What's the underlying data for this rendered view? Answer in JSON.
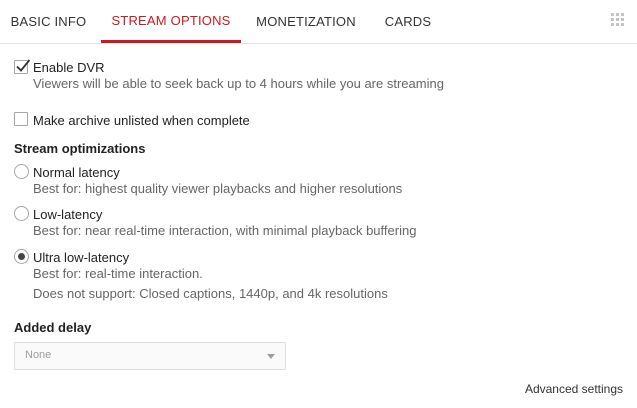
{
  "tabs": {
    "basic_info": "BASIC INFO",
    "stream_options": "STREAM OPTIONS",
    "monetization": "MONETIZATION",
    "cards": "CARDS"
  },
  "active_tab": "STREAM OPTIONS",
  "accent_color": "#cc181e",
  "dvr": {
    "label": "Enable DVR",
    "checked": true,
    "description": "Viewers will be able to seek back up to 4 hours while you are streaming"
  },
  "archive": {
    "label": "Make archive unlisted when complete",
    "checked": false
  },
  "optimizations": {
    "heading": "Stream optimizations",
    "options": [
      {
        "label": "Normal latency",
        "desc": "Best for: highest quality viewer playbacks and higher resolutions",
        "selected": false
      },
      {
        "label": "Low-latency",
        "desc": "Best for: near real-time interaction, with minimal playback buffering",
        "selected": false
      },
      {
        "label": "Ultra low-latency",
        "desc": "Best for: real-time interaction.",
        "desc2": "Does not support: Closed captions, 1440p, and 4k resolutions",
        "selected": true
      }
    ]
  },
  "added_delay": {
    "heading": "Added delay",
    "value": "None"
  },
  "advanced_settings": "Advanced settings"
}
